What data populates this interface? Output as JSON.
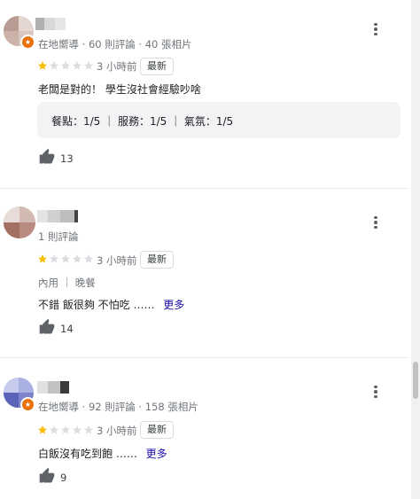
{
  "reviews": [
    {
      "reviewer_meta": "在地嚮導 · 60 則評論 · 40 張相片",
      "rating_stars": 1,
      "time": "3 小時前",
      "new_tag": "最新",
      "text": "老闆是對的！ 學生沒社會經驗吵啥",
      "sub_ratings": "餐點：1/5 ｜ 服務：1/5 ｜ 氣氛：1/5",
      "likes": "13"
    },
    {
      "reviewer_meta": "1 則評論",
      "rating_stars": 1,
      "time": "3 小時前",
      "new_tag": "最新",
      "dining": "內用 ｜ 晚餐",
      "text": "不錯 飯很夠 不怕吃 ……",
      "more": "更多",
      "likes": "14"
    },
    {
      "reviewer_meta": "在地嚮導 · 92 則評論 · 158 張相片",
      "rating_stars": 1,
      "time": "3 小時前",
      "new_tag": "最新",
      "text": "白飯沒有吃到飽 ……",
      "more": "更多",
      "likes": "9"
    }
  ],
  "colors": {
    "star_filled": "#fbbc04",
    "star_empty": "#dadce0",
    "local_guide_badge": "#e8710a",
    "more_link": "#1a0dab"
  }
}
